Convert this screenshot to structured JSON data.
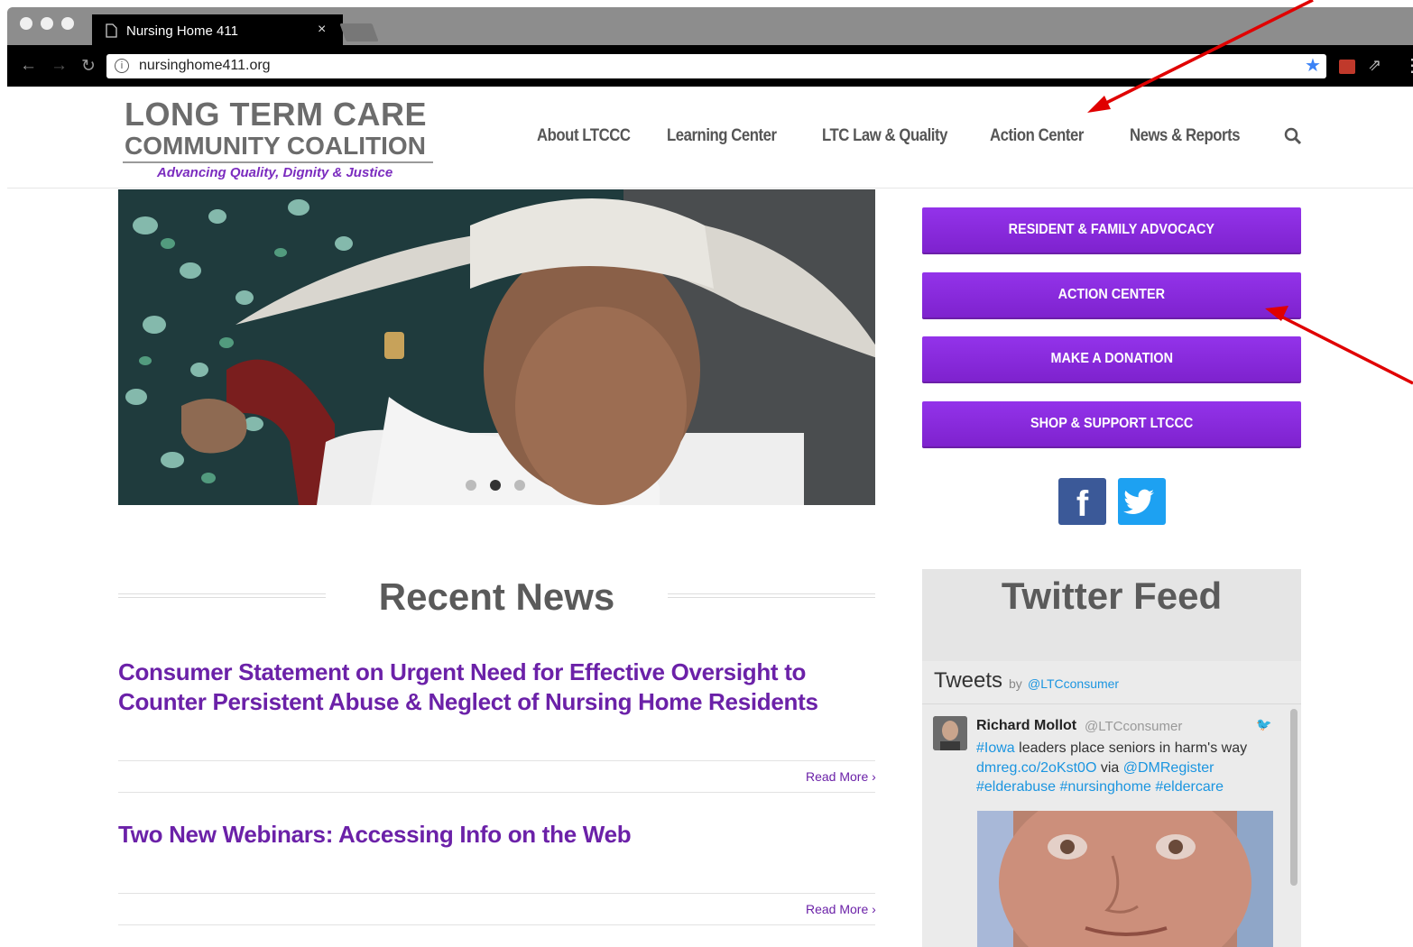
{
  "browser": {
    "tab_title": "Nursing Home 411",
    "tab_close": "×",
    "url": "nursinghome411.org",
    "icons": [
      "back-icon",
      "forward-icon",
      "reload-icon",
      "info-icon",
      "star-icon",
      "menu-icon"
    ]
  },
  "logo": {
    "line1": "LONG TERM CARE",
    "line2": "COMMUNITY COALITION",
    "tagline": "Advancing Quality, Dignity & Justice"
  },
  "nav": {
    "items": [
      "About LTCCC",
      "Learning Center",
      "LTC Law & Quality",
      "Action Center",
      "News & Reports"
    ]
  },
  "sidebar_buttons": [
    "RESIDENT & FAMILY ADVOCACY",
    "ACTION CENTER",
    "MAKE A DONATION",
    "SHOP & SUPPORT LTCCC"
  ],
  "social": {
    "facebook": "f"
  },
  "recent_news": {
    "title": "Recent News",
    "posts": [
      {
        "title": "Consumer Statement on Urgent Need for Effective Oversight to Counter Persistent Abuse & Neglect of Nursing Home Residents",
        "read_more": "Read More ›"
      },
      {
        "title": "Two New Webinars: Accessing Info on the Web",
        "read_more": "Read More ›"
      }
    ]
  },
  "twitter": {
    "title": "Twitter Feed",
    "tweets_label": "Tweets",
    "by": "by",
    "handle": "@LTCconsumer",
    "tweet": {
      "name": "Richard Mollot",
      "handle": "@LTCconsumer",
      "line1_tag": "#Iowa",
      "line1_text": " leaders place seniors in harm's way",
      "line2_link": "dmreg.co/2oKst0O",
      "line2_via": " via ",
      "line2_mention": "@DMRegister",
      "line3": "#elderabuse #nursinghome #eldercare"
    }
  },
  "colors": {
    "brand_purple": "#7e22ce",
    "facebook": "#3b5998",
    "twitter": "#1da1f2",
    "annotation_arrow": "#e00000"
  }
}
